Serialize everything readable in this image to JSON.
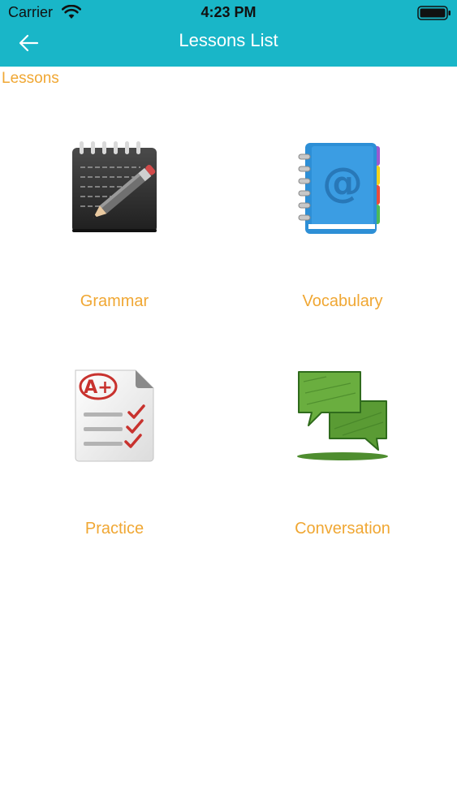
{
  "status_bar": {
    "carrier": "Carrier",
    "time": "4:23 PM",
    "wifi_icon": "wifi-icon",
    "battery_icon": "battery-icon"
  },
  "nav": {
    "title": "Lessons List",
    "back_icon": "arrow-left-icon"
  },
  "section": {
    "label": "Lessons"
  },
  "lessons": [
    {
      "label": "Grammar",
      "icon": "notepad-pencil-icon"
    },
    {
      "label": "Vocabulary",
      "icon": "address-book-icon"
    },
    {
      "label": "Practice",
      "icon": "graded-test-icon"
    },
    {
      "label": "Conversation",
      "icon": "speech-bubbles-icon"
    }
  ],
  "colors": {
    "header": "#19b6c8",
    "accent_text": "#f0a733",
    "background": "#ffffff"
  }
}
